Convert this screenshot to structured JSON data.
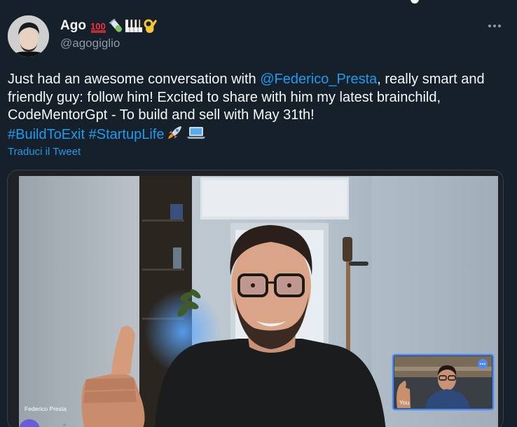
{
  "author": {
    "name": "Ago",
    "handle": "@agogiglio",
    "emoji_names": [
      "hundred-points-icon",
      "test-tube-icon",
      "piano-keys-icon",
      "ok-hand-icon"
    ]
  },
  "tweet": {
    "text_before": "Just had an awesome conversation with ",
    "mention": "@Federico_Presta",
    "text_after": ", really smart and friendly guy: follow him! Excited to share with him my latest brainchild, CodeMentorGpt - To build and sell with May 31th!",
    "hashtag_1": "#BuildToExit",
    "hashtag_2": "#StartupLife",
    "trailing_icons": [
      "rocket-icon",
      "laptop-icon"
    ]
  },
  "translate_label": "Traduci il Tweet",
  "media": {
    "main_participant_name": "Federico Presta",
    "self_view_label": "You"
  },
  "colors": {
    "background": "#15202b",
    "link": "#1d9bf0",
    "secondary_text": "#8b98a5",
    "self_view_border": "#4c8bf5"
  }
}
